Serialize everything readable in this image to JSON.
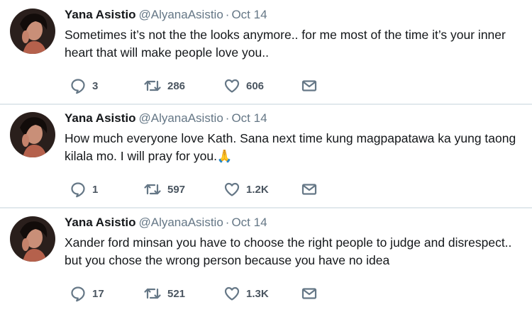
{
  "tweets": [
    {
      "name": "Yana Asistio",
      "handle": "@AlyanaAsistio",
      "separator": "·",
      "date": "Oct 14",
      "text": "Sometimes it’s not the the looks anymore.. for me most of the time it’s your inner heart that will make people love you..",
      "replies": "3",
      "retweets": "286",
      "likes": "606"
    },
    {
      "name": "Yana Asistio",
      "handle": "@AlyanaAsistio",
      "separator": "·",
      "date": "Oct 14",
      "text": "How much everyone love Kath. Sana next time kung magpapatawa ka yung taong kilala mo. I will pray for you.🙏",
      "replies": "1",
      "retweets": "597",
      "likes": "1.2K"
    },
    {
      "name": "Yana Asistio",
      "handle": "@AlyanaAsistio",
      "separator": "·",
      "date": "Oct 14",
      "text": "Xander ford minsan you have to choose the right people to judge and disrespect.. but you chose the wrong person because you have no idea",
      "replies": "17",
      "retweets": "521",
      "likes": "1.3K"
    }
  ],
  "icons": {
    "reply": "reply-icon",
    "retweet": "retweet-icon",
    "like": "heart-icon",
    "message": "envelope-icon"
  },
  "colors": {
    "text": "#14171a",
    "muted": "#657786",
    "divider": "#e1e8ed"
  }
}
